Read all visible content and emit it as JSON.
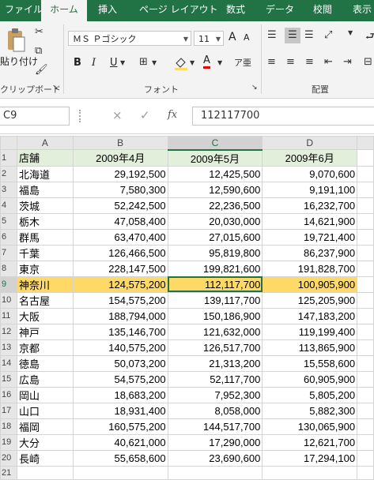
{
  "tabs": [
    "ファイル",
    "ホーム",
    "挿入",
    "ページ レイアウト",
    "数式",
    "データ",
    "校閲",
    "表示"
  ],
  "active_tab": "ホーム",
  "ribbon": {
    "clipboard_label": "クリップボード",
    "paste_label": "貼り付け",
    "font_label": "フォント",
    "alignment_label": "配置",
    "font_name": "ＭＳ Ｐゴシック",
    "font_size": "11",
    "bold": "B",
    "italic": "I",
    "underline": "U",
    "font_color_glyph": "A",
    "grow_font": "A",
    "shrink_font": "A"
  },
  "formula_bar": {
    "name_box": "C9",
    "cancel": "×",
    "enter": "✓",
    "fx": "fx",
    "content": "112117700"
  },
  "columns": [
    "A",
    "B",
    "C",
    "D"
  ],
  "selected_column": "C",
  "selected_row": 9,
  "header_row": [
    "店舗",
    "2009年4月",
    "2009年5月",
    "2009年6月"
  ],
  "rows": [
    [
      "北海道",
      "29,192,500",
      "12,425,500",
      "9,070,600"
    ],
    [
      "福島",
      "7,580,300",
      "12,590,600",
      "9,191,100"
    ],
    [
      "茨城",
      "52,242,500",
      "22,236,500",
      "16,232,700"
    ],
    [
      "栃木",
      "47,058,400",
      "20,030,000",
      "14,621,900"
    ],
    [
      "群馬",
      "63,470,400",
      "27,015,600",
      "19,721,400"
    ],
    [
      "千葉",
      "126,466,500",
      "95,819,800",
      "86,237,900"
    ],
    [
      "東京",
      "228,147,500",
      "199,821,600",
      "191,828,700"
    ],
    [
      "神奈川",
      "124,575,200",
      "112,117,700",
      "100,905,900"
    ],
    [
      "名古屋",
      "154,575,200",
      "139,117,700",
      "125,205,900"
    ],
    [
      "大阪",
      "188,794,000",
      "150,186,900",
      "147,183,200"
    ],
    [
      "神戸",
      "135,146,700",
      "121,632,000",
      "119,199,400"
    ],
    [
      "京都",
      "140,575,200",
      "126,517,700",
      "113,865,900"
    ],
    [
      "徳島",
      "50,073,200",
      "21,313,200",
      "15,558,600"
    ],
    [
      "広島",
      "54,575,200",
      "52,117,700",
      "60,905,900"
    ],
    [
      "岡山",
      "18,683,200",
      "7,952,300",
      "5,805,200"
    ],
    [
      "山口",
      "18,931,400",
      "8,058,000",
      "5,882,300"
    ],
    [
      "福岡",
      "160,575,200",
      "144,517,700",
      "130,065,900"
    ],
    [
      "大分",
      "40,621,000",
      "17,290,000",
      "12,621,700"
    ],
    [
      "長崎",
      "55,658,600",
      "23,690,600",
      "17,294,100"
    ]
  ],
  "colors": {
    "excel_green": "#217346",
    "header_fill": "#e2efda",
    "highlight_fill": "#ffd966"
  }
}
